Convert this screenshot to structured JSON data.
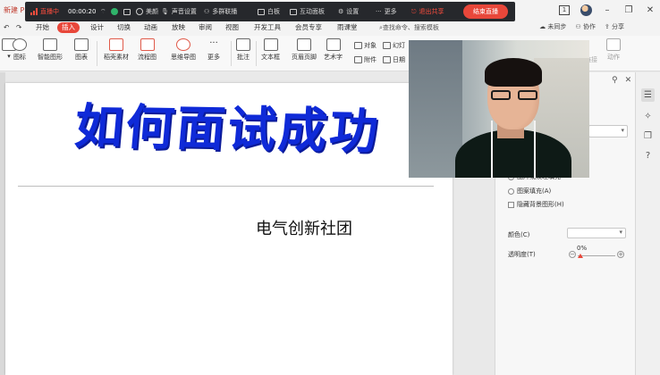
{
  "title_bar": {
    "doc_title": "新建 PPT"
  },
  "live_bar": {
    "status": "直播中",
    "timer": "00:00:20",
    "beauty": "美颜",
    "audio_settings": "声音设置",
    "multi_link": "多群联播",
    "whiteboard": "白板",
    "interactive_panel": "互动面板",
    "settings": "设置",
    "more": "更多",
    "exit_share": "退出共享",
    "end_live": "结束直播"
  },
  "menu": {
    "tabs": [
      "开始",
      "插入",
      "设计",
      "切换",
      "动画",
      "放映",
      "审阅",
      "视图",
      "开发工具",
      "会员专享",
      "雨课堂"
    ],
    "active_tab": "插入",
    "search": "查找命令、搜索模板",
    "sync": "未同步",
    "collab": "协作",
    "share": "分享"
  },
  "ribbon": {
    "icons_label": "图标",
    "smart_shape": "智能图形",
    "chart": "图表",
    "assets": "稻壳素材",
    "flowchart": "流程图",
    "mindmap": "思维导图",
    "more": "更多",
    "comment": "批注",
    "textbox": "文本框",
    "header_footer": "页眉页脚",
    "art_text": "艺术字",
    "object": "对象",
    "attachment": "附件",
    "slide": "幻灯",
    "date": "日期",
    "action": "动作",
    "hyperlink": "链接"
  },
  "slide": {
    "title": "如何面试成功",
    "subtitle": "电气创新社团"
  },
  "panel": {
    "options": [
      "图片或纹理填充",
      "图案填充(A)"
    ],
    "hide_bg": "隐藏背景图形(H)",
    "color_label": "颜色(C)",
    "transparency_label": "透明度(T)",
    "transparency_value": "0%"
  }
}
